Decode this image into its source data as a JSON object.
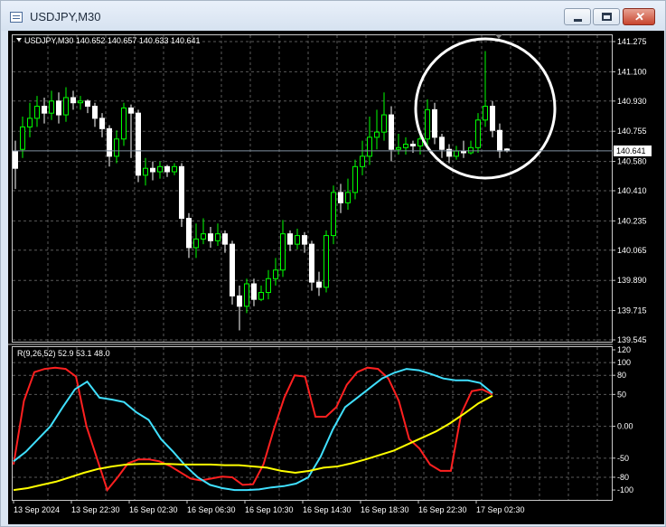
{
  "window": {
    "title": "USDJPY,M30",
    "minimize_icon": "minimize-icon",
    "maximize_icon": "maximize-icon",
    "close_icon": "close-icon",
    "close_glyph": "✕"
  },
  "chart": {
    "header": "USDJPY,M30  140.652 140.657 140.633 140.641",
    "current_price_label": "140.641",
    "current_price": 140.641
  },
  "indicator": {
    "header": "R(9,26,52) 52.9 53.1 48.0"
  },
  "chart_data": [
    {
      "type": "candlestick",
      "title": "USDJPY,M30",
      "y_ticks": [
        "141.275",
        "141.100",
        "140.930",
        "140.755",
        "140.580",
        "140.410",
        "140.235",
        "140.065",
        "139.890",
        "139.715",
        "139.545"
      ],
      "ylim": [
        139.545,
        141.275
      ],
      "x_ticks": [
        "13 Sep 2024",
        "13 Sep 22:30",
        "16 Sep 02:30",
        "16 Sep 06:30",
        "16 Sep 10:30",
        "16 Sep 14:30",
        "16 Sep 18:30",
        "16 Sep 22:30",
        "17 Sep 02:30"
      ],
      "bull_color": "#00ff00",
      "bear_color": "#ffffff",
      "annotation": "white circle around most recent candles",
      "candles": [
        [
          140.64,
          140.54,
          140.7,
          140.42
        ],
        [
          140.65,
          140.78,
          140.84,
          140.6
        ],
        [
          140.78,
          140.83,
          140.92,
          140.72
        ],
        [
          140.83,
          140.9,
          140.96,
          140.78
        ],
        [
          140.9,
          140.86,
          140.95,
          140.8
        ],
        [
          140.86,
          140.93,
          140.99,
          140.82
        ],
        [
          140.93,
          140.85,
          140.98,
          140.8
        ],
        [
          140.85,
          140.95,
          141.01,
          140.81
        ],
        [
          140.95,
          140.92,
          140.99,
          140.88
        ],
        [
          140.92,
          140.93,
          140.96,
          140.88
        ],
        [
          140.93,
          140.9,
          140.94,
          140.86
        ],
        [
          140.9,
          140.83,
          140.92,
          140.78
        ],
        [
          140.83,
          140.77,
          140.86,
          140.72
        ],
        [
          140.77,
          140.61,
          140.79,
          140.55
        ],
        [
          140.61,
          140.71,
          140.76,
          140.57
        ],
        [
          140.71,
          140.89,
          140.92,
          140.67
        ],
        [
          140.89,
          140.86,
          140.91,
          140.6
        ],
        [
          140.86,
          140.5,
          140.88,
          140.46
        ],
        [
          140.5,
          140.54,
          140.6,
          140.44
        ],
        [
          140.54,
          140.52,
          140.58,
          140.47
        ],
        [
          140.52,
          140.55,
          140.58,
          140.48
        ],
        [
          140.55,
          140.52,
          140.56,
          140.49
        ],
        [
          140.52,
          140.55,
          140.57,
          140.5
        ],
        [
          140.55,
          140.25,
          140.57,
          140.2
        ],
        [
          140.25,
          140.08,
          140.28,
          140.02
        ],
        [
          140.08,
          140.13,
          140.22,
          140.02
        ],
        [
          140.13,
          140.16,
          140.25,
          140.1
        ],
        [
          140.16,
          140.12,
          140.2,
          140.08
        ],
        [
          140.12,
          140.16,
          140.22,
          140.09
        ],
        [
          140.16,
          140.1,
          140.18,
          140.05
        ],
        [
          140.1,
          139.8,
          140.12,
          139.75
        ],
        [
          139.8,
          139.74,
          139.86,
          139.6
        ],
        [
          139.74,
          139.87,
          139.9,
          139.7
        ],
        [
          139.87,
          139.78,
          139.9,
          139.74
        ],
        [
          139.78,
          139.82,
          139.86,
          139.77
        ],
        [
          139.82,
          139.9,
          139.95,
          139.78
        ],
        [
          139.9,
          139.95,
          140.02,
          139.86
        ],
        [
          139.95,
          140.16,
          140.24,
          139.91
        ],
        [
          140.16,
          140.1,
          140.18,
          140.06
        ],
        [
          140.1,
          140.15,
          140.19,
          140.07
        ],
        [
          140.15,
          140.1,
          140.17,
          140.05
        ],
        [
          140.1,
          139.88,
          140.12,
          139.83
        ],
        [
          139.88,
          139.85,
          139.94,
          139.8
        ],
        [
          139.85,
          140.15,
          140.18,
          139.82
        ],
        [
          140.15,
          140.4,
          140.44,
          140.1
        ],
        [
          140.4,
          140.34,
          140.45,
          140.28
        ],
        [
          140.34,
          140.4,
          140.48,
          140.3
        ],
        [
          140.4,
          140.55,
          140.59,
          140.36
        ],
        [
          140.55,
          140.61,
          140.7,
          140.5
        ],
        [
          140.61,
          140.72,
          140.84,
          140.56
        ],
        [
          140.72,
          140.75,
          140.88,
          140.65
        ],
        [
          140.75,
          140.85,
          140.98,
          140.7
        ],
        [
          140.85,
          140.65,
          140.9,
          140.58
        ],
        [
          140.65,
          140.66,
          140.74,
          140.62
        ],
        [
          140.66,
          140.68,
          140.72,
          140.62
        ],
        [
          140.68,
          140.67,
          140.7,
          140.63
        ],
        [
          140.67,
          140.71,
          140.76,
          140.62
        ],
        [
          140.71,
          140.88,
          140.94,
          140.67
        ],
        [
          140.88,
          140.72,
          140.92,
          140.68
        ],
        [
          140.72,
          140.65,
          140.74,
          140.6
        ],
        [
          140.65,
          140.61,
          140.68,
          140.57
        ],
        [
          140.61,
          140.64,
          140.67,
          140.59
        ],
        [
          140.64,
          140.63,
          140.7,
          140.6
        ],
        [
          140.63,
          140.66,
          140.7,
          140.62
        ],
        [
          140.66,
          140.82,
          140.86,
          140.63
        ],
        [
          140.82,
          140.9,
          141.22,
          140.78
        ],
        [
          140.9,
          140.76,
          140.93,
          140.72
        ],
        [
          140.76,
          140.64,
          140.8,
          140.6
        ],
        [
          140.652,
          140.641,
          140.657,
          140.633
        ]
      ]
    },
    {
      "type": "line",
      "title": "R(9,26,52)",
      "y_ticks": [
        120,
        100,
        80,
        50,
        0.0,
        -50,
        -80,
        -100
      ],
      "ylim": [
        -107,
        120
      ],
      "series": [
        {
          "color": "#ff2020",
          "values": [
            -60,
            40,
            85,
            90,
            92,
            90,
            78,
            0,
            -50,
            -100,
            -80,
            -58,
            -52,
            -52,
            -55,
            -62,
            -72,
            -82,
            -85,
            -82,
            -79,
            -80,
            -92,
            -91,
            -60,
            -5,
            45,
            80,
            78,
            15,
            15,
            30,
            65,
            85,
            92,
            90,
            75,
            40,
            -20,
            -35,
            -60,
            -70,
            -70,
            20,
            55,
            58,
            50
          ]
        },
        {
          "color": "#40e0ff",
          "values": [
            -55,
            -40,
            -20,
            0,
            30,
            58,
            70,
            45,
            42,
            38,
            22,
            10,
            -20,
            -40,
            -62,
            -80,
            -92,
            -97,
            -100,
            -100,
            -99,
            -96,
            -94,
            -90,
            -80,
            -48,
            -5,
            30,
            45,
            60,
            75,
            84,
            90,
            88,
            82,
            75,
            72,
            72,
            68,
            52
          ]
        },
        {
          "color": "#ffff00",
          "values": [
            -100,
            -97,
            -92,
            -87,
            -80,
            -73,
            -67,
            -63,
            -60,
            -59,
            -59,
            -59,
            -60,
            -60,
            -60,
            -61,
            -61,
            -63,
            -65,
            -70,
            -73,
            -70,
            -65,
            -63,
            -58,
            -52,
            -45,
            -38,
            -28,
            -18,
            -8,
            5,
            20,
            36,
            48
          ]
        }
      ]
    }
  ]
}
